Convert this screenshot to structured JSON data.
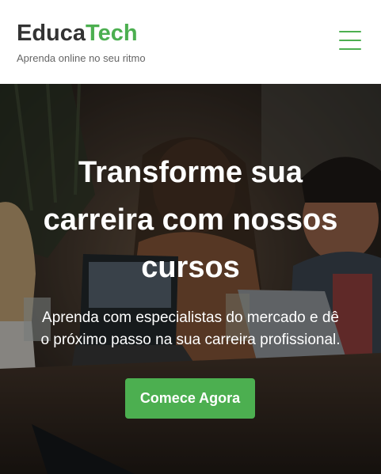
{
  "header": {
    "logo_part1": "Educa",
    "logo_part2": "Tech",
    "tagline": "Aprenda online no seu ritmo",
    "menu_icon": "hamburger-menu-icon"
  },
  "hero": {
    "title_line1": "Transforme sua",
    "title_line2": "carreira com nossos",
    "title_line3": "cursos",
    "subtitle_line1": "Aprenda com especialistas do mercado e dê",
    "subtitle_line2": "o próximo passo na sua carreira profissional.",
    "cta_label": "Comece Agora"
  },
  "colors": {
    "brand_green": "#4caf50",
    "logo_dark": "#333333",
    "tagline_gray": "#666666"
  }
}
